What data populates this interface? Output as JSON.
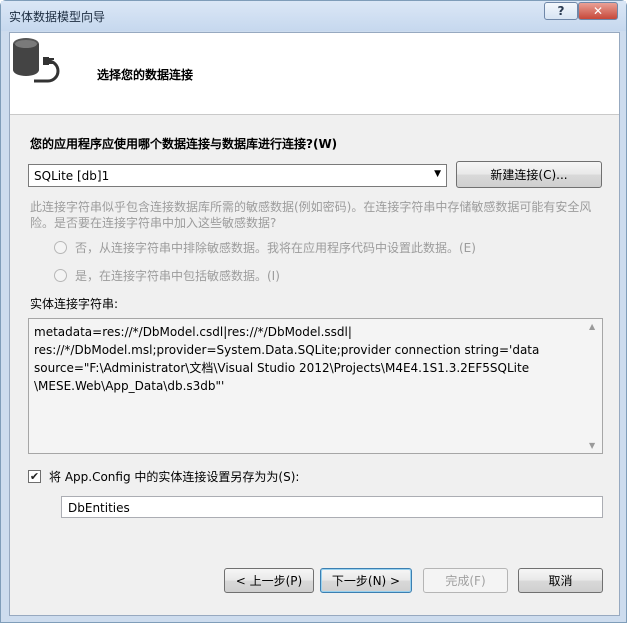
{
  "window": {
    "title": "实体数据模型向导",
    "help_label": "?",
    "close_label": "✕"
  },
  "header": {
    "title": "选择您的数据连接",
    "icon": "database-plug-icon"
  },
  "connection": {
    "question": "您的应用程序应使用哪个数据连接与数据库进行连接?(W)",
    "selected": "SQLite [db]1",
    "new_button": "新建连接(C)..."
  },
  "sensitive": {
    "hint": "此连接字符串似乎包含连接数据库所需的敏感数据(例如密码)。在连接字符串中存储敏感数据可能有安全风险。是否要在连接字符串中加入这些敏感数据?",
    "option_exclude": "否，从连接字符串中排除敏感数据。我将在应用程序代码中设置此数据。(E)",
    "option_include": "是，在连接字符串中包括敏感数据。(I)"
  },
  "entity_connection": {
    "label": "实体连接字符串:",
    "lines": [
      "metadata=res://*/DbModel.csdl|res://*/DbModel.ssdl|",
      "res://*/DbModel.msl;provider=System.Data.SQLite;provider connection string='data",
      "source=\"F:\\Administrator\\文档\\Visual Studio 2012\\Projects\\M4E4.1S1.3.2EF5SQLite",
      "\\MESE.Web\\App_Data\\db.s3db\"'"
    ]
  },
  "save": {
    "checked": true,
    "label": "将 App.Config 中的实体连接设置另存为为(S):",
    "value": "DbEntities"
  },
  "buttons": {
    "back": "< 上一步(P)",
    "next": "下一步(N) >",
    "finish": "完成(F)",
    "cancel": "取消"
  }
}
